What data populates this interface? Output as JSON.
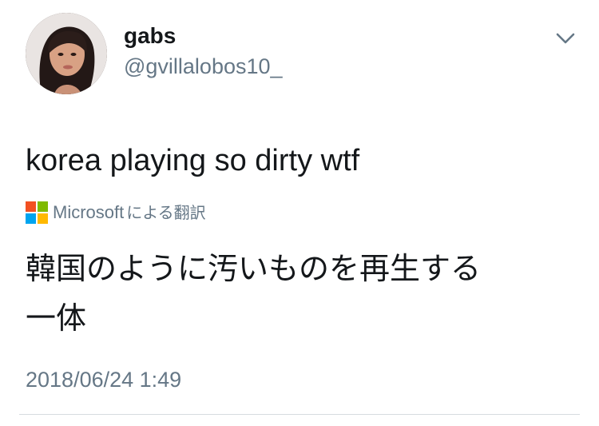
{
  "user": {
    "display_name": "gabs",
    "handle": "@gvillalobos10_"
  },
  "tweet": {
    "text": "korea playing so dirty wtf",
    "timestamp": "2018/06/24 1:49"
  },
  "translation": {
    "provider": "Microsoft",
    "provider_suffix": "による翻訳",
    "lines": [
      "韓国のように汚いものを再生する",
      "一体"
    ]
  },
  "icons": {
    "avatar": "profile-photo",
    "menu": "chevron-down-icon",
    "provider_logo": "microsoft-logo"
  },
  "colors": {
    "text": "#14171a",
    "secondary": "#657786",
    "ms_red": "#f25022",
    "ms_green": "#7fba00",
    "ms_blue": "#00a4ef",
    "ms_yellow": "#ffb900"
  }
}
